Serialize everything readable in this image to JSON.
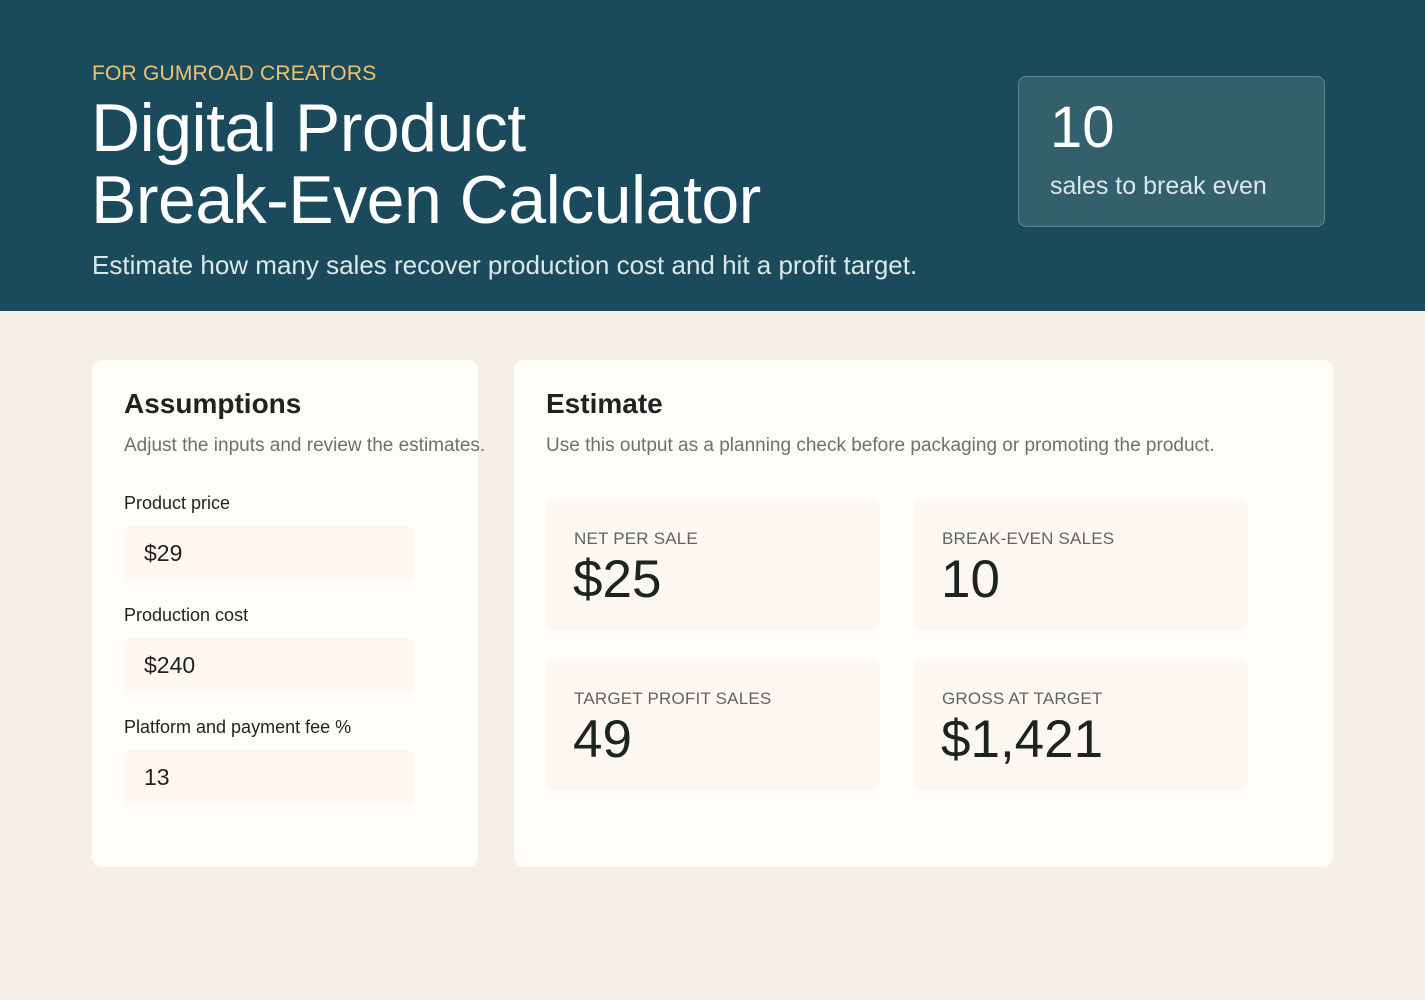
{
  "header": {
    "eyebrow": "FOR GUMROAD CREATORS",
    "title_line1": "Digital Product",
    "title_line2": "Break-Even Calculator",
    "subtitle": "Estimate how many sales recover production cost and hit a profit target.",
    "summary": {
      "value": "10",
      "label": "sales to break even"
    }
  },
  "assumptions": {
    "title": "Assumptions",
    "description": "Adjust the inputs and review the estimates.",
    "fields": [
      {
        "label": "Product price",
        "value": "$29"
      },
      {
        "label": "Production cost",
        "value": "$240"
      },
      {
        "label": "Platform and payment fee %",
        "value": "13"
      }
    ]
  },
  "estimate": {
    "title": "Estimate",
    "description": "Use this output as a planning check before packaging or promoting the product.",
    "metrics": [
      {
        "label": "NET PER SALE",
        "value": "$25"
      },
      {
        "label": "BREAK-EVEN SALES",
        "value": "10"
      },
      {
        "label": "TARGET PROFIT SALES",
        "value": "49"
      },
      {
        "label": "GROSS AT TARGET",
        "value": "$1,421"
      }
    ]
  },
  "colors": {
    "header_bg": "#1b4a5c",
    "eyebrow": "#f0c46e",
    "page_bg": "#f6efe6",
    "panel_bg": "#fffdf8"
  }
}
